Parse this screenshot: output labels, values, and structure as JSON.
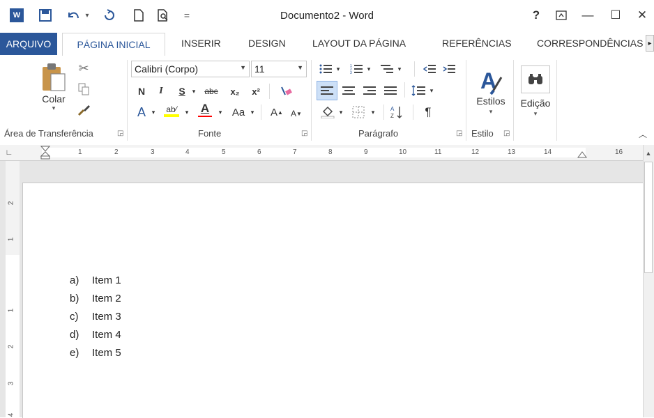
{
  "window": {
    "title": "Documento2 - Word",
    "help": "?",
    "ribbon_options": "⊡",
    "minimize": "—",
    "maximize": "☐",
    "close": "✕"
  },
  "quick_access": {
    "app_icon": "W",
    "save": "💾",
    "undo": "↶",
    "undo_drop": "▾",
    "redo": "↺",
    "new": "🗋",
    "print_preview": "🔍",
    "customize": "="
  },
  "tabs": [
    "ARQUIVO",
    "PÁGINA INICIAL",
    "INSERIR",
    "DESIGN",
    "LAYOUT DA PÁGINA",
    "REFERÊNCIAS",
    "CORRESPONDÊNCIAS"
  ],
  "ribbon": {
    "clipboard": {
      "paste_label": "Colar",
      "group_label": "Área de Transferência"
    },
    "font": {
      "name": "Calibri (Corpo)",
      "size": "11",
      "bold": "N",
      "italic": "I",
      "underline": "S",
      "strike": "abc",
      "subscript": "x₂",
      "superscript": "x²",
      "case": "Aa",
      "grow": "A",
      "shrink": "A",
      "group_label": "Fonte"
    },
    "paragraph": {
      "pilcrow": "¶",
      "group_label": "Parágrafo"
    },
    "styles": {
      "label": "Estilos",
      "group_label": "Estilo"
    },
    "editing": {
      "label": "Edição"
    }
  },
  "ruler": {
    "numbers": [
      "1",
      "2",
      "3",
      "4",
      "5",
      "6",
      "7",
      "8",
      "9",
      "10",
      "11",
      "12",
      "13",
      "14",
      "16"
    ],
    "vertical_numbers": [
      "2",
      "1",
      "1",
      "2",
      "3",
      "4"
    ]
  },
  "document": {
    "list": [
      {
        "marker": "a)",
        "text": "Item 1"
      },
      {
        "marker": "b)",
        "text": "Item 2"
      },
      {
        "marker": "c)",
        "text": "Item 3"
      },
      {
        "marker": "d)",
        "text": "Item 4"
      },
      {
        "marker": "e)",
        "text": "Item 5"
      }
    ]
  },
  "colors": {
    "accent": "#2b579a",
    "highlight": "#ffff00",
    "font_color": "#ff0000"
  }
}
